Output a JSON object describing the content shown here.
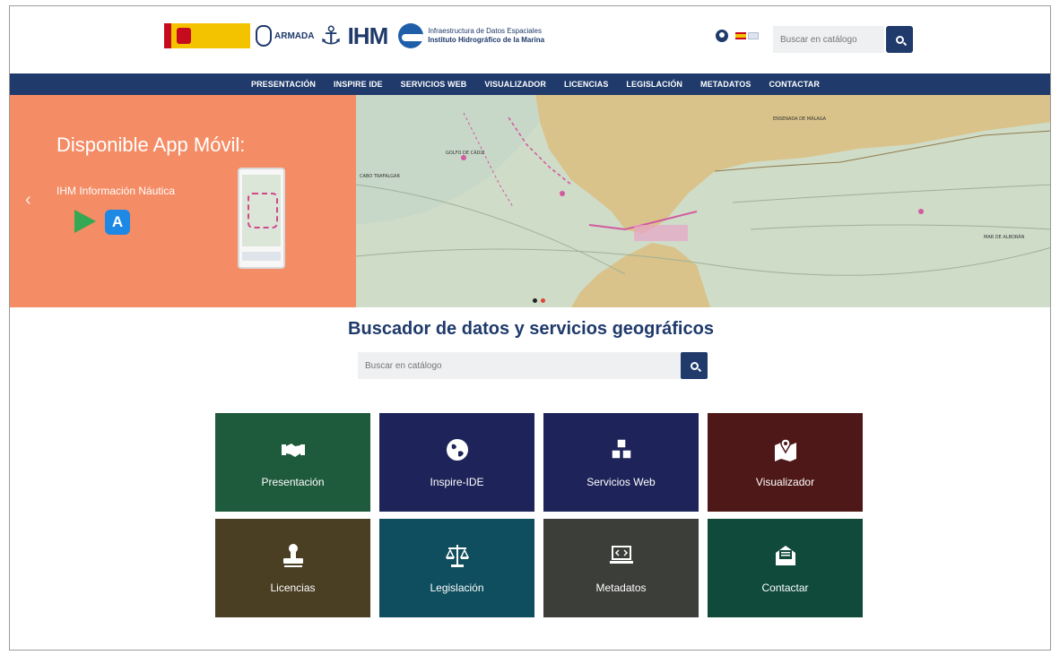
{
  "header": {
    "logo_armada": "ARMADA",
    "logo_ihm": "IHM",
    "logo_ide_line1": "Infraestructura de Datos Espaciales",
    "logo_ide_line2": "Instituto Hidrográfico de la Marina",
    "search_placeholder": "Buscar en catálogo"
  },
  "nav": {
    "items": [
      "PRESENTACIÓN",
      "INSPIRE IDE",
      "SERVICIOS WEB",
      "VISUALIZADOR",
      "LICENCIAS",
      "LEGISLACIÓN",
      "METADATOS",
      "CONTACTAR"
    ]
  },
  "hero": {
    "title": "Disponible App Móvil:",
    "subtitle": "IHM Información Náutica",
    "prev_arrow": "‹",
    "appstore_glyph": "A",
    "color_left": "#f48c65",
    "map_labels": [
      "ENSENADA DE MÁLAGA",
      "GOLFO DE CÁDIZ",
      "CABO TRAFALGAR",
      "MAR DE ALBORÁN"
    ]
  },
  "main": {
    "title": "Buscador de datos y servicios geográficos",
    "search_placeholder": "Buscar en catálogo"
  },
  "tiles": [
    {
      "label": "Presentación",
      "icon": "handshake-icon",
      "color": "#1e5a3c"
    },
    {
      "label": "Inspire-IDE",
      "icon": "globe-icon",
      "color": "#1e2459"
    },
    {
      "label": "Servicios Web",
      "icon": "cubes-icon",
      "color": "#1e2459"
    },
    {
      "label": "Visualizador",
      "icon": "map-marker-icon",
      "color": "#4f1818"
    },
    {
      "label": "Licencias",
      "icon": "stamp-icon",
      "color": "#4a3f23"
    },
    {
      "label": "Legislación",
      "icon": "balance-scale-icon",
      "color": "#0f4e5e"
    },
    {
      "label": "Metadatos",
      "icon": "laptop-code-icon",
      "color": "#3c3e3a"
    },
    {
      "label": "Contactar",
      "icon": "envelope-open-icon",
      "color": "#0f4a3a"
    }
  ],
  "colors": {
    "brand": "#1f3a6b",
    "accent": "#f48c65"
  }
}
